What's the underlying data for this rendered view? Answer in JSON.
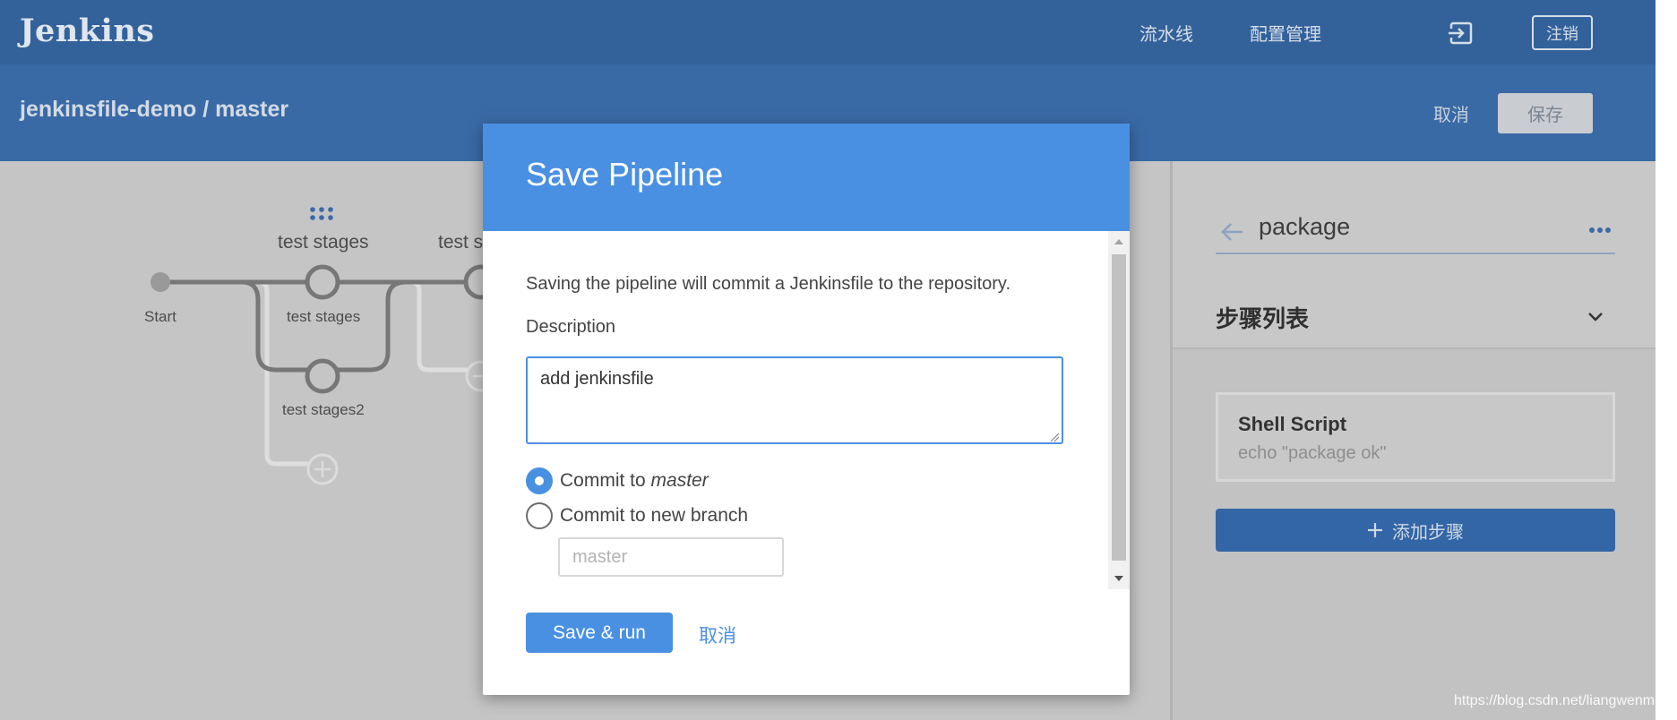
{
  "header": {
    "logo": "Jenkins",
    "nav": {
      "pipelines": "流水线",
      "administration": "配置管理"
    },
    "login_icon": "login-icon",
    "logout_label": "注销"
  },
  "subheader": {
    "breadcrumb": "jenkinsfile-demo / master",
    "cancel_label": "取消",
    "save_label": "保存"
  },
  "graph": {
    "stage_titles": [
      "test stages",
      "test s"
    ],
    "nodes": {
      "start": "Start",
      "stage1": "test stages",
      "stage2": "test stages2"
    },
    "icons": {
      "grip": "drag-grip-icon",
      "add": "add-node-icon"
    }
  },
  "panel": {
    "stage_name": "package",
    "steps_title": "步骤列表",
    "step": {
      "title": "Shell Script",
      "subtitle": "echo \"package ok\""
    },
    "add_step_label": "添加步骤",
    "icons": {
      "back": "back-arrow-icon",
      "more": "more-icon",
      "collapse": "chevron-down-icon",
      "add": "plus-icon"
    }
  },
  "modal": {
    "title": "Save Pipeline",
    "message": "Saving the pipeline will commit a Jenkinsfile to the repository.",
    "description_label": "Description",
    "description_value": "add jenkinsfile",
    "commit_to_prefix": "Commit to",
    "commit_branch": "master",
    "commit_new_label": "Commit to new branch",
    "branch_placeholder": "master",
    "save_run_label": "Save & run",
    "cancel_label": "取消"
  },
  "watermark": "https://blog.csdn.net/liangwenmai",
  "colors": {
    "header": "#33629b",
    "subheader": "#3a6aa6",
    "modal_accent": "#4a90e2",
    "canvas": "#c5c5c5"
  }
}
